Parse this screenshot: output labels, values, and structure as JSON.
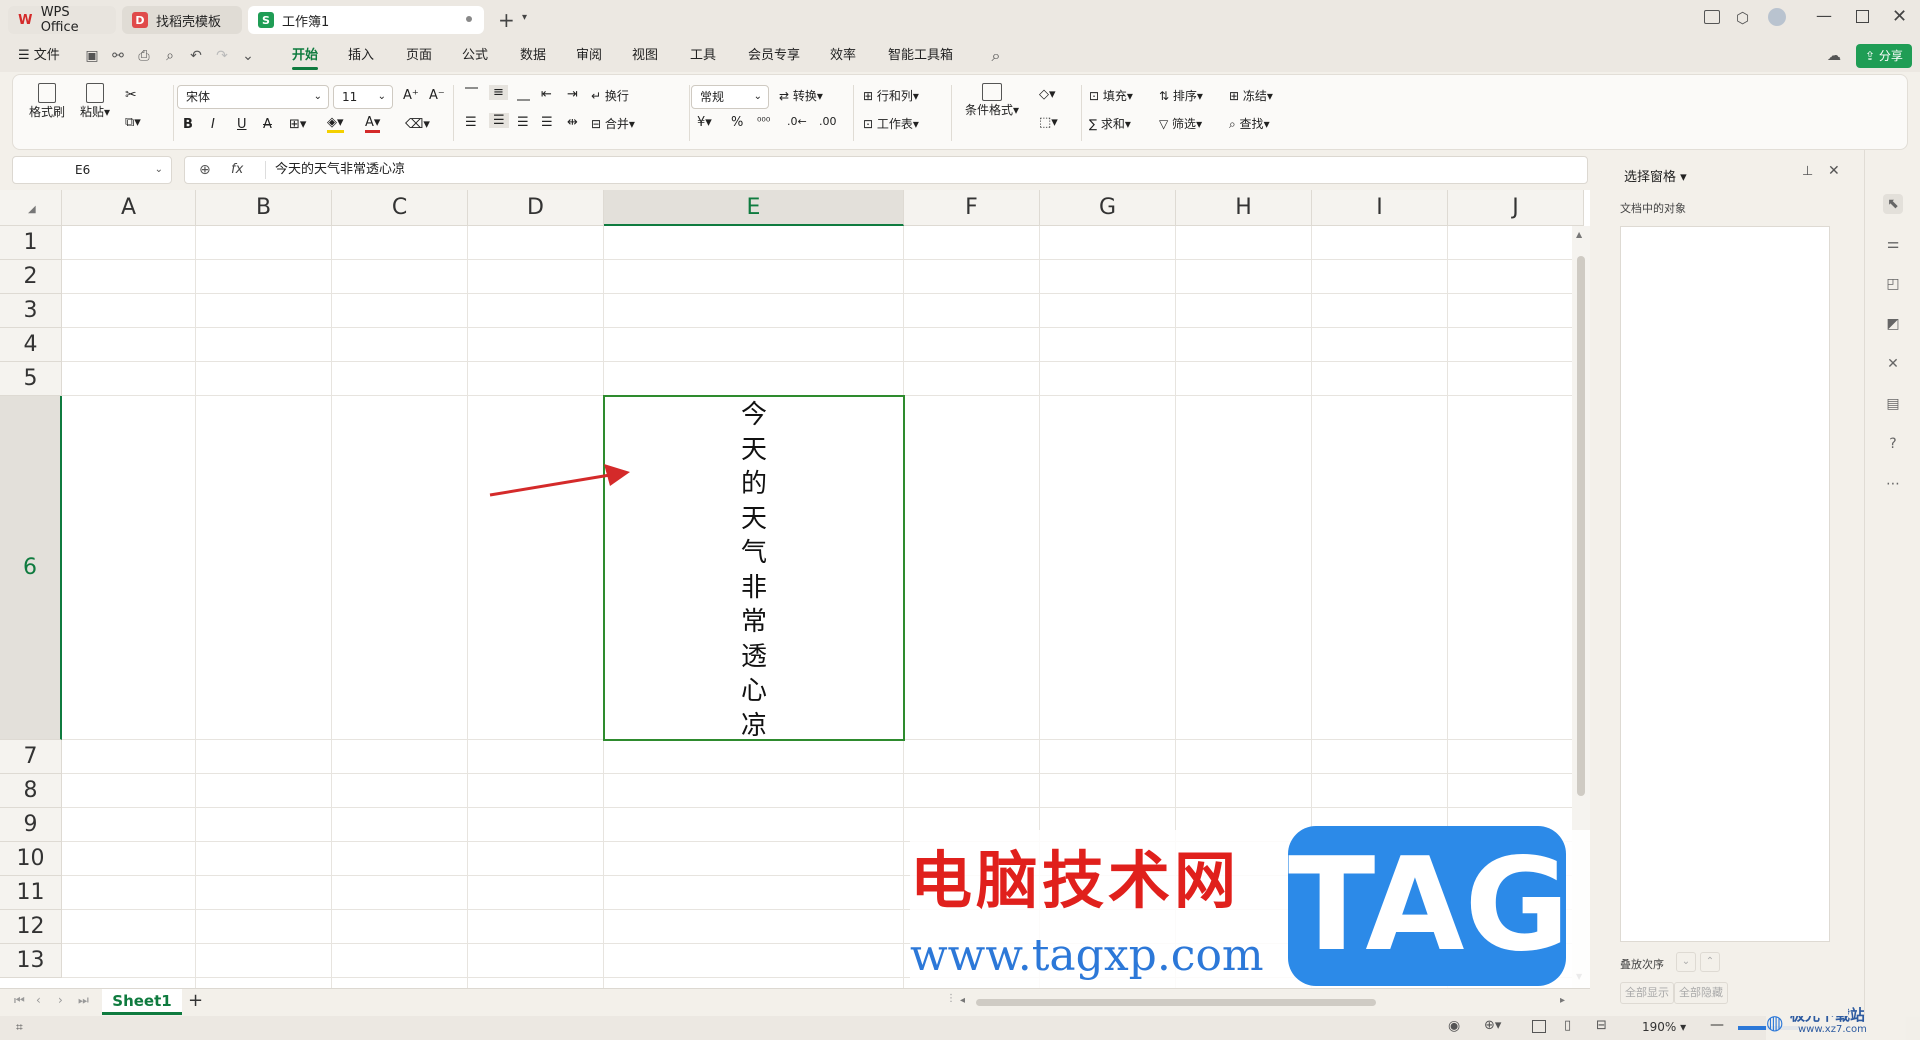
{
  "tabs": [
    {
      "label": "WPS Office",
      "icon": "wps-logo-icon"
    },
    {
      "label": "找稻壳模板",
      "icon": "docer-icon"
    },
    {
      "label": "工作簿1",
      "icon": "spreadsheet-icon"
    }
  ],
  "menu": {
    "file": "文件",
    "items": [
      "开始",
      "插入",
      "页面",
      "公式",
      "数据",
      "审阅",
      "视图",
      "工具",
      "会员专享",
      "效率",
      "智能工具箱"
    ],
    "active": "开始",
    "share": "分享"
  },
  "ribbon": {
    "format_painter": "格式刷",
    "paste": "粘贴",
    "font_name": "宋体",
    "font_size": "11",
    "wrap": "换行",
    "merge": "合并",
    "number_format": "常规",
    "convert": "转换",
    "rows_cols": "行和列",
    "worksheet": "工作表",
    "conditional_format": "条件格式",
    "fill": "填充",
    "sort": "排序",
    "freeze": "冻结",
    "sum": "求和",
    "filter": "筛选",
    "find": "查找",
    "currency_symbol": "¥",
    "percent_symbol": "%"
  },
  "formula_bar": {
    "cell_ref": "E6",
    "fx": "fx",
    "content": "今天的天气非常透心凉"
  },
  "grid": {
    "columns": [
      "A",
      "B",
      "C",
      "D",
      "E",
      "F",
      "G",
      "H",
      "I",
      "J"
    ],
    "rows": [
      "1",
      "2",
      "3",
      "4",
      "5",
      "6",
      "7",
      "8",
      "9",
      "10",
      "11",
      "12",
      "13"
    ],
    "selected_column": "E",
    "selected_row": "6",
    "cell_E6": "今天的天气非常透心凉"
  },
  "sheet_tabs": {
    "active": "Sheet1",
    "add": "+"
  },
  "selection_pane": {
    "title": "选择窗格",
    "objects_label": "文档中的对象",
    "stack_order": "叠放次序",
    "show_all": "全部显示",
    "hide_all": "全部隐藏"
  },
  "status": {
    "zoom": "190%"
  },
  "watermark": {
    "site_cn": "电脑技术网",
    "site_url": "www.tagxp.com",
    "tag": "TAG",
    "corner": "极光下载站",
    "corner_url": "www.xz7.com"
  },
  "colors": {
    "accent": "#0f7b3f",
    "selection": "#2e8b2e",
    "arrow": "#d42a2a",
    "tag_blue": "#2c8ae8",
    "wm_red": "#e0201c"
  }
}
